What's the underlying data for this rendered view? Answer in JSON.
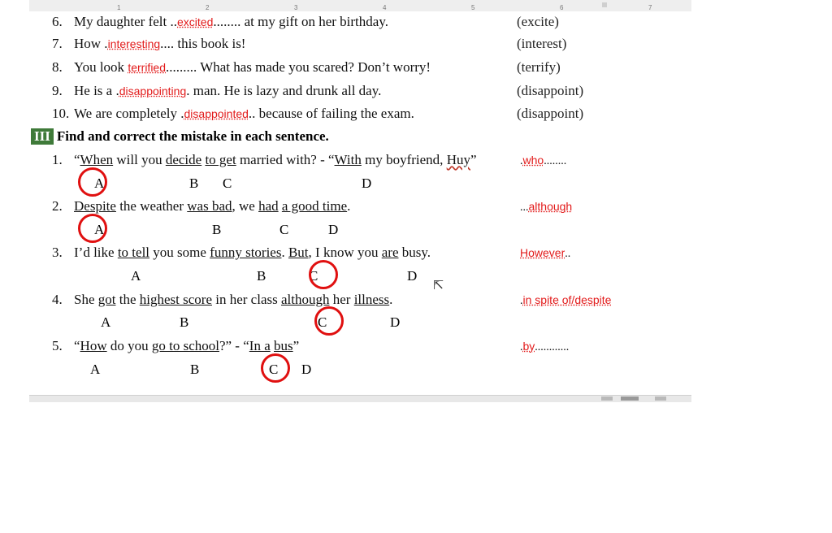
{
  "ruler": {
    "ticks": [
      "1",
      "2",
      "3",
      "4",
      "5",
      "6",
      "7"
    ]
  },
  "part2": [
    {
      "num": "6.",
      "before": "My daughter felt ..",
      "answer": "excited",
      "after": "........ at my gift on her birthday.",
      "hint": "(excite)"
    },
    {
      "num": "7.",
      "before": "How .",
      "answer": "interesting",
      "after": ".... this book is!",
      "hint": "(interest)"
    },
    {
      "num": "8.",
      "before": "You look ",
      "answer": "terrified",
      "after": "......... What has made you scared? Don’t worry!",
      "hint": "(terrify)"
    },
    {
      "num": "9.",
      "before": "He is a .",
      "answer": "disappointing",
      "after": ". man. He is lazy and drunk all day.",
      "hint": "(disappoint)"
    },
    {
      "num": "10.",
      "before": "We are completely .",
      "answer": "disappointed",
      "after": ".. because of failing the exam.",
      "hint": "(disappoint)"
    }
  ],
  "section3": {
    "badge": "III",
    "title": "Find and correct the mistake in each sentence."
  },
  "part3": [
    {
      "num": "1.",
      "segments": [
        {
          "t": "“"
        },
        {
          "t": "When",
          "u": true
        },
        {
          "t": " will you "
        },
        {
          "t": "decide",
          "u": true
        },
        {
          "t": " "
        },
        {
          "t": "to get",
          "u": true
        },
        {
          "t": " married with? - “"
        },
        {
          "t": "With",
          "u": true
        },
        {
          "t": " my boyfriend, "
        },
        {
          "t": "Huy",
          "sq": true
        },
        {
          "t": "”"
        }
      ],
      "options": [
        "A",
        "B",
        "C",
        "D"
      ],
      "circled": "A",
      "answer": "who",
      "answer_suffix": "........",
      "answer_prefix": "."
    },
    {
      "num": "2.",
      "segments": [
        {
          "t": "Despite",
          "u": true
        },
        {
          "t": " the weather "
        },
        {
          "t": "was bad",
          "u": true
        },
        {
          "t": ", we "
        },
        {
          "t": "had",
          "u": true
        },
        {
          "t": " "
        },
        {
          "t": "a good time",
          "u": true
        },
        {
          "t": "."
        }
      ],
      "options": [
        "A",
        "B",
        "C",
        "D"
      ],
      "circled": "A",
      "answer": "although",
      "answer_suffix": "",
      "answer_prefix": "..."
    },
    {
      "num": "3.",
      "segments": [
        {
          "t": "I’d like "
        },
        {
          "t": "to tell",
          "u": true
        },
        {
          "t": " you some "
        },
        {
          "t": "funny stories",
          "u": true
        },
        {
          "t": ". "
        },
        {
          "t": "But",
          "u": true
        },
        {
          "t": ", I know you "
        },
        {
          "t": "are",
          "u": true
        },
        {
          "t": " busy."
        }
      ],
      "options": [
        "A",
        "B",
        "C",
        "D"
      ],
      "circled": "C",
      "answer": "However",
      "answer_suffix": "..",
      "answer_prefix": ""
    },
    {
      "num": "4.",
      "segments": [
        {
          "t": "She "
        },
        {
          "t": "got",
          "u": true
        },
        {
          "t": " the "
        },
        {
          "t": "highest score",
          "u": true
        },
        {
          "t": " in her class "
        },
        {
          "t": "although",
          "u": true
        },
        {
          "t": " her "
        },
        {
          "t": "illness",
          "u": true
        },
        {
          "t": "."
        }
      ],
      "options": [
        "A",
        "B",
        "C",
        "D"
      ],
      "circled": "C",
      "answer": "in spite of/despite",
      "answer_suffix": "",
      "answer_prefix": "."
    },
    {
      "num": "5.",
      "segments": [
        {
          "t": "“"
        },
        {
          "t": "How",
          "u": true
        },
        {
          "t": " do you "
        },
        {
          "t": "go to school",
          "u": true
        },
        {
          "t": "?” - “"
        },
        {
          "t": "In a",
          "u": true
        },
        {
          "t": " "
        },
        {
          "t": "bus",
          "u": true
        },
        {
          "t": "”"
        }
      ],
      "options": [
        "A",
        "B",
        "C",
        "D"
      ],
      "circled": "C",
      "answer": "by",
      "answer_suffix": "............",
      "answer_prefix": "."
    }
  ]
}
